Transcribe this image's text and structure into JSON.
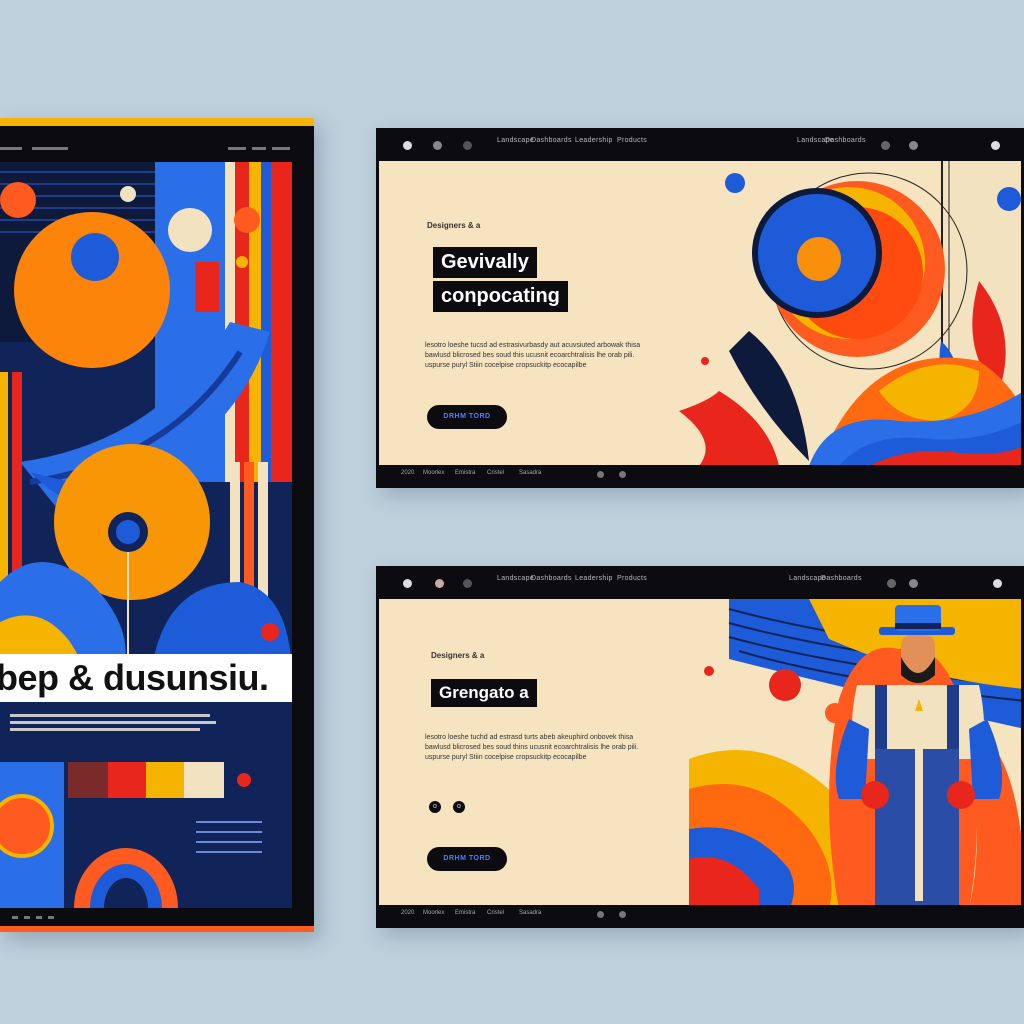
{
  "colors": {
    "background": "#bdd0dc",
    "cream": "#f6e3bf",
    "ink": "#0b0b10",
    "orange": "#ff5a1f",
    "yellow": "#f5b400",
    "blue": "#1e5bd8",
    "red": "#e8261c",
    "navy": "#10245a"
  },
  "poster": {
    "title": "bep & dusunsiu.",
    "palette": [
      "#7a2a2a",
      "#e8261c",
      "#f5b400",
      "#f3e2c0"
    ]
  },
  "window_top": {
    "eyebrow": "Designers & a",
    "headline_line1": "Gevivally",
    "headline_line2": "conpocating",
    "body": [
      "lesotro loeshe tucsd ad estrasivurbasdy aut acuvsiuted arbowak thisa",
      "bawlusd blicrosed bes soud this ucusnit ecoarchtralisis lhe orab pili.",
      "uspurse puryl Stiin cocelpise cropsuckitp ecocapilbe"
    ],
    "cta": "DRHM TORD"
  },
  "window_bottom": {
    "eyebrow": "Designers & a",
    "headline": "Grengato a",
    "body": [
      "lesotro loeshe tuchd ad estrasd turts abeb akeuphird onbovek thisa",
      "bawlusd blicrosed bes soud thins ucusnit ecoarchtralisis lhe orab pili.",
      "uspurse puryl Stiin cocelpise cropsuckitp ecocapilbe"
    ],
    "mini_icons": [
      "o",
      "o"
    ],
    "cta": "DRHM TORD"
  },
  "nav_items": [
    "Landscape",
    "Dashboards",
    "Leadership",
    "Products"
  ],
  "footer_items": [
    "2020",
    "Moorlex",
    "Emistra",
    "Cristel",
    "Sasadra"
  ]
}
